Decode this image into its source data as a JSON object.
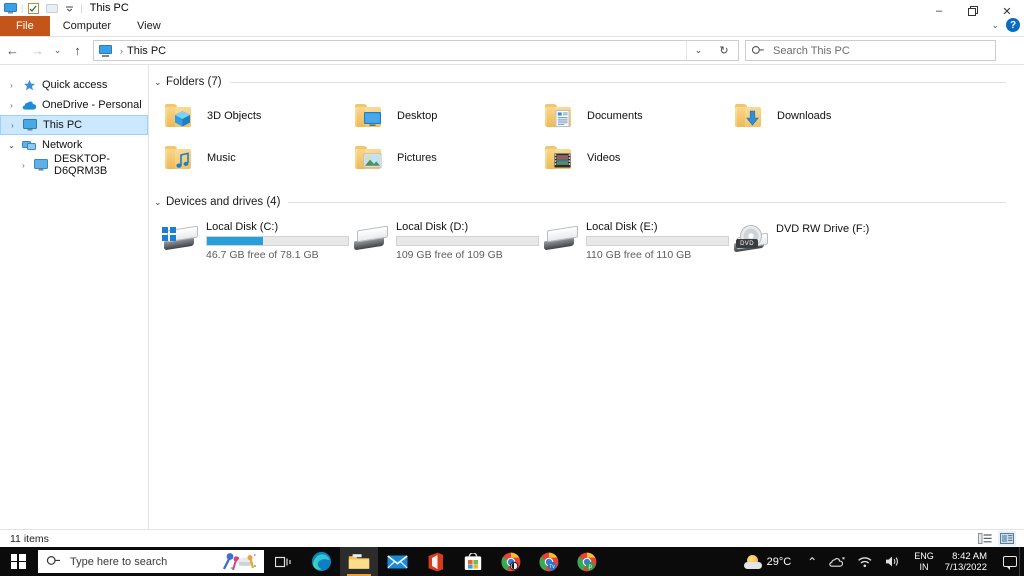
{
  "window": {
    "title": "This PC",
    "quick_access_icons": [
      "this-pc-icon",
      "properties-icon",
      "new-folder-icon",
      "customize-dropdown-icon"
    ],
    "controls": {
      "minimize": "–",
      "maximize": "❐",
      "close": "✕"
    },
    "ribbon_expand": "⌄",
    "help": "?"
  },
  "ribbon": {
    "tabs": [
      {
        "label": "File",
        "active_file": true
      },
      {
        "label": "Computer",
        "active_file": false
      },
      {
        "label": "View",
        "active_file": false
      }
    ]
  },
  "navigation": {
    "back": "←",
    "forward": "→",
    "recent": "⌄",
    "up": "↑",
    "breadcrumb": {
      "root_icon": "this-pc-icon",
      "separator": "›",
      "path": "This PC"
    },
    "address_dropdown": "⌄",
    "refresh": "↻"
  },
  "search": {
    "placeholder": "Search This PC",
    "icon": "search-icon"
  },
  "sidebar": {
    "items": [
      {
        "label": "Quick access",
        "icon": "star-icon",
        "chevron": "›",
        "expanded": false,
        "selected": false,
        "indent": false
      },
      {
        "label": "OneDrive - Personal",
        "icon": "cloud-icon",
        "chevron": "›",
        "expanded": false,
        "selected": false,
        "indent": false
      },
      {
        "label": "This PC",
        "icon": "monitor-icon",
        "chevron": "›",
        "expanded": false,
        "selected": true,
        "indent": false
      },
      {
        "label": "Network",
        "icon": "network-icon",
        "chevron": "⌄",
        "expanded": true,
        "selected": false,
        "indent": false
      },
      {
        "label": "DESKTOP-D6QRM3B",
        "icon": "monitor-icon",
        "chevron": "›",
        "expanded": false,
        "selected": false,
        "indent": true
      }
    ]
  },
  "content": {
    "groups": [
      {
        "title": "Folders (7)",
        "chevron": "⌄",
        "items": [
          {
            "label": "3D Objects",
            "icon": "folder-3d-objects-icon"
          },
          {
            "label": "Desktop",
            "icon": "folder-desktop-icon"
          },
          {
            "label": "Documents",
            "icon": "folder-documents-icon"
          },
          {
            "label": "Downloads",
            "icon": "folder-downloads-icon"
          },
          {
            "label": "Music",
            "icon": "folder-music-icon"
          },
          {
            "label": "Pictures",
            "icon": "folder-pictures-icon"
          },
          {
            "label": "Videos",
            "icon": "folder-videos-icon"
          }
        ]
      },
      {
        "title": "Devices and drives (4)",
        "chevron": "⌄",
        "items": [
          {
            "label": "Local Disk (C:)",
            "icon": "windows-drive-icon",
            "free_text": "46.7 GB free of 78.1 GB",
            "used_percent": 40,
            "has_bar": true
          },
          {
            "label": "Local Disk (D:)",
            "icon": "drive-icon",
            "free_text": "109 GB free of 109 GB",
            "used_percent": 0,
            "has_bar": true
          },
          {
            "label": "Local Disk (E:)",
            "icon": "drive-icon",
            "free_text": "110 GB free of 110 GB",
            "used_percent": 0,
            "has_bar": true
          },
          {
            "label": "DVD RW Drive (F:)",
            "icon": "dvd-drive-icon",
            "free_text": "",
            "used_percent": 0,
            "has_bar": false
          }
        ]
      }
    ]
  },
  "statusbar": {
    "item_count": "11 items",
    "view_buttons": [
      {
        "name": "details-view-button",
        "active": false
      },
      {
        "name": "large-icons-view-button",
        "active": true
      }
    ]
  },
  "taskbar": {
    "start": "start-button",
    "search_placeholder": "Type here to search",
    "search_decoration": "confetti-icon",
    "icons": [
      {
        "name": "task-view-icon",
        "glyph": "⧉",
        "active": false
      },
      {
        "name": "microsoft-edge-icon",
        "glyph": "",
        "active": false
      },
      {
        "name": "file-explorer-icon",
        "glyph": "",
        "active": true
      },
      {
        "name": "mail-icon",
        "glyph": "",
        "active": false
      },
      {
        "name": "office-icon",
        "glyph": "",
        "active": false
      },
      {
        "name": "microsoft-store-icon",
        "glyph": "",
        "active": false
      },
      {
        "name": "chrome-app-icon",
        "glyph": "",
        "active": false
      },
      {
        "name": "chrome-tv-app-icon",
        "glyph": "",
        "active": false
      },
      {
        "name": "chrome-p-app-icon",
        "glyph": "",
        "active": false
      }
    ],
    "tray": {
      "weather_temp": "29°C",
      "weather_icon": "partly-sunny-icon",
      "overflow": "⌃",
      "onedrive_icon": "onedrive-tray-icon",
      "network_icon": "wifi-icon",
      "volume_icon": "speaker-icon",
      "language_line1": "ENG",
      "language_line2": "IN",
      "time": "8:42 AM",
      "date": "7/13/2022",
      "action_center": "notification-icon"
    }
  },
  "colors": {
    "accent_blue": "#26a0da",
    "file_tab": "#c3551b",
    "selection": "#cce8ff",
    "taskbar": "#0b0b0b",
    "help_blue": "#0a6cbe"
  }
}
